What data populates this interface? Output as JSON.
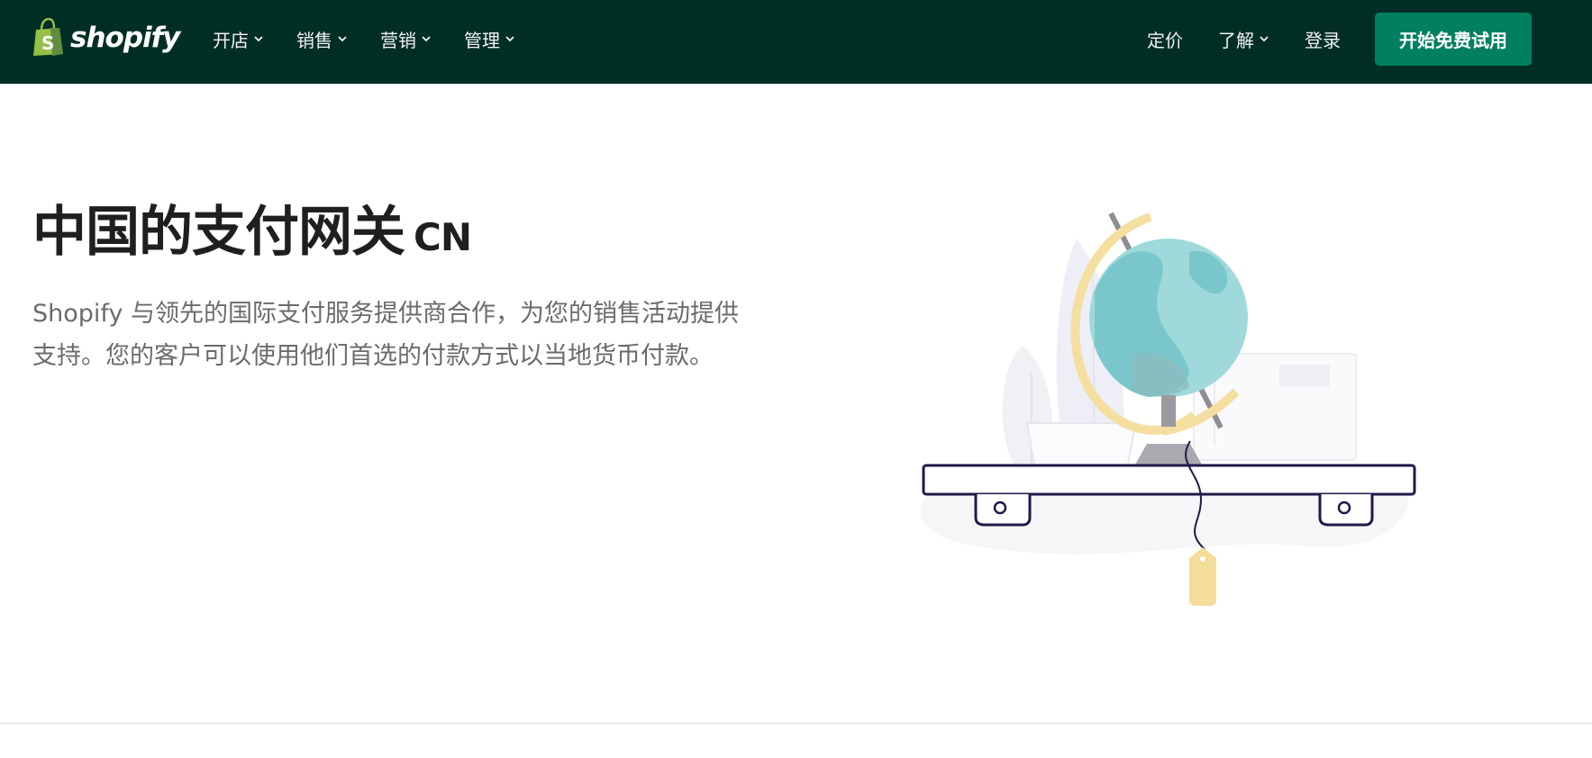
{
  "brand": {
    "name": "shopify",
    "logo_icon": "shopping-bag-icon",
    "colors": {
      "nav_background": "#002e25",
      "cta_background": "#008060",
      "bag_green": "#95bf47"
    }
  },
  "nav": {
    "left_items": [
      {
        "label": "开店"
      },
      {
        "label": "销售"
      },
      {
        "label": "营销"
      },
      {
        "label": "管理"
      }
    ],
    "right_items": [
      {
        "label": "定价"
      },
      {
        "label": "了解"
      },
      {
        "label": "登录"
      }
    ],
    "cta_label": "开始免费试用"
  },
  "hero": {
    "title": "中国的支付网关",
    "title_suffix": "CN",
    "description": "Shopify 与领先的国际支付服务提供商合作，为您的销售活动提供支持。您的客户可以使用他们首选的付款方式以当地货币付款。",
    "illustration": "globe-on-shelf-illustration"
  }
}
